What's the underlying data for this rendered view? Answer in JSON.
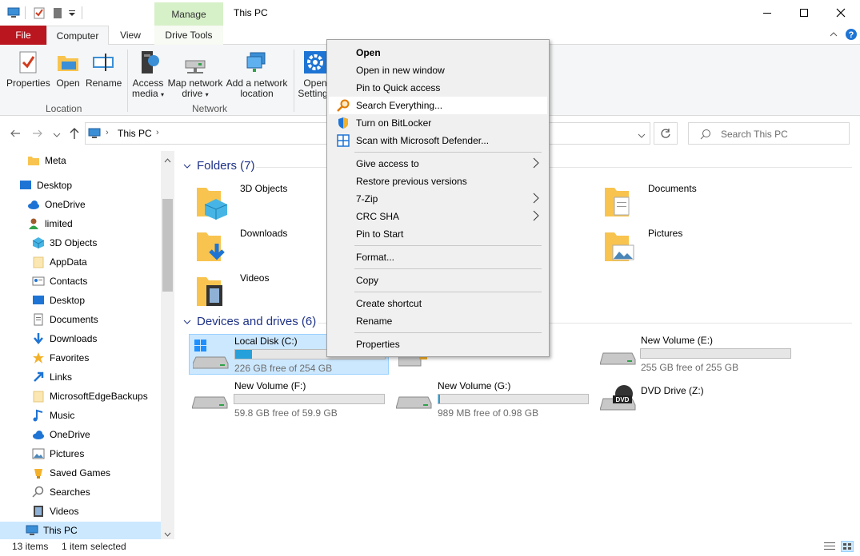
{
  "titlebar": {
    "manage_tab": "Manage",
    "title": "This PC",
    "qat_icons": [
      "computer-icon",
      "properties-check-icon",
      "folder-gray-icon",
      "dropdown-arrow-icon"
    ]
  },
  "tabs": {
    "file": "File",
    "computer": "Computer",
    "view": "View",
    "drive_tools": "Drive Tools"
  },
  "ribbon": {
    "properties": "Properties",
    "open": "Open",
    "rename": "Rename",
    "location_group": "Location",
    "access_media_1": "Access",
    "access_media_2": "media",
    "map_drive_1": "Map network",
    "map_drive_2": "drive",
    "add_location_1": "Add a network",
    "add_location_2": "location",
    "network_group": "Network",
    "open_settings_1": "Open",
    "open_settings_2": "Settings"
  },
  "address": {
    "path": "This PC",
    "search_placeholder": "Search This PC"
  },
  "nav": {
    "items": [
      {
        "label": "Meta",
        "icon": "folder-icon"
      },
      {
        "label": "Desktop",
        "icon": "desktop-icon"
      },
      {
        "label": "OneDrive",
        "icon": "cloud-icon"
      },
      {
        "label": "limited",
        "icon": "user-icon"
      },
      {
        "label": "3D Objects",
        "icon": "cube-icon"
      },
      {
        "label": "AppData",
        "icon": "folder-light-icon"
      },
      {
        "label": "Contacts",
        "icon": "contacts-icon"
      },
      {
        "label": "Desktop",
        "icon": "desktop-icon"
      },
      {
        "label": "Documents",
        "icon": "document-icon"
      },
      {
        "label": "Downloads",
        "icon": "download-icon"
      },
      {
        "label": "Favorites",
        "icon": "star-icon"
      },
      {
        "label": "Links",
        "icon": "link-icon"
      },
      {
        "label": "MicrosoftEdgeBackups",
        "icon": "folder-light-icon"
      },
      {
        "label": "Music",
        "icon": "music-icon"
      },
      {
        "label": "OneDrive",
        "icon": "cloud-icon"
      },
      {
        "label": "Pictures",
        "icon": "pictures-icon"
      },
      {
        "label": "Saved Games",
        "icon": "games-icon"
      },
      {
        "label": "Searches",
        "icon": "search-icon"
      },
      {
        "label": "Videos",
        "icon": "video-icon"
      },
      {
        "label": "This PC",
        "icon": "computer-icon"
      }
    ]
  },
  "content": {
    "folders_head": "Folders (7)",
    "folders": [
      "3D Objects",
      "Documents",
      "Downloads",
      "Pictures",
      "Videos"
    ],
    "devices_head": "Devices and drives (6)",
    "drives": [
      {
        "name": "Local Disk (C:)",
        "free": "226 GB free of 254 GB",
        "used_fraction": 0.11
      },
      {
        "name": "New Volume (E:)",
        "free": "255 GB free of 255 GB",
        "used_fraction": 0.0
      },
      {
        "name": "New Volume (F:)",
        "free": "59.8 GB free of 59.9 GB",
        "used_fraction": 0.0
      },
      {
        "name": "New Volume (G:)",
        "free": "989 MB free of 0.98 GB",
        "used_fraction": 0.01
      },
      {
        "name": "DVD Drive (Z:)"
      }
    ]
  },
  "context_menu": {
    "open": "Open",
    "open_new_window": "Open in new window",
    "pin_quick": "Pin to Quick access",
    "search_everything": "Search Everything...",
    "bitlocker": "Turn on BitLocker",
    "defender": "Scan with Microsoft Defender...",
    "give_access": "Give access to",
    "restore": "Restore previous versions",
    "zip": "7-Zip",
    "crc": "CRC SHA",
    "pin_start": "Pin to Start",
    "format": "Format...",
    "copy": "Copy",
    "shortcut": "Create shortcut",
    "rename": "Rename",
    "properties": "Properties"
  },
  "status": {
    "items": "13 items",
    "selected": "1 item selected"
  },
  "colors": {
    "file_tab": "#b9161f",
    "manage_tab": "#d6f0c8",
    "selection": "#cce8ff",
    "drive_fill": "#26a0da",
    "section_head": "#1e3287"
  }
}
